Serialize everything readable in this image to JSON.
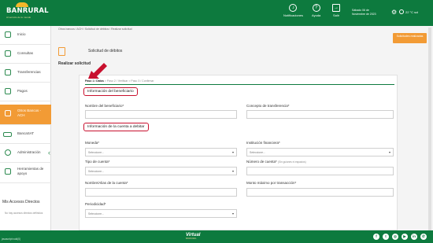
{
  "header": {
    "logo_name": "BANRURAL",
    "logo_tagline": "Al servicio de tu mundo",
    "notifications_label": "Notificaciones",
    "help_label": "Ayuda",
    "exit_label": "Salir",
    "date_line1": "Sábado 06 de",
    "date_line2": "Noviembre de 2023",
    "temperature": "22 °C sol"
  },
  "sidebar": {
    "items": [
      {
        "label": "Inicio"
      },
      {
        "label": "Consultas"
      },
      {
        "label": "Transferencias"
      },
      {
        "label": "Pagos"
      },
      {
        "label": "Gestiones"
      },
      {
        "label": "Otros Bancos - ACH"
      },
      {
        "label": "BancaSAT"
      },
      {
        "label": "Administración"
      },
      {
        "label": "Herramientas de apoyo"
      }
    ],
    "access_title": "Mis Accesos Directos",
    "access_note": "No hay accesos directos definidos"
  },
  "main": {
    "breadcrumb": "Otros bancos / ACH / Solicitud de débitos / Realizar solicitud",
    "top_button": "Solicitudes realizadas",
    "page_title": "Solicitud de débitos",
    "section_title": "Realizar solicitud",
    "steps": {
      "current": "Paso 1 / Datos",
      "rest": "  >  Paso 2 / Verificar  >  Paso 3 / Confirmar"
    },
    "beneficiary_heading": "Información del beneficiario",
    "account_heading": "Información de la cuenta a debitar",
    "fields": {
      "beneficiary_name": {
        "label": "Nombre del beneficiario*",
        "value": ""
      },
      "transfer_concept": {
        "label": "Concepto de transferencia*",
        "value": ""
      },
      "currency": {
        "label": "Moneda*",
        "value": "Seleccione..."
      },
      "institution": {
        "label": "Institución financiera*",
        "value": "Seleccione..."
      },
      "account_type": {
        "label": "Tipo de cuenta*",
        "value": "Seleccione..."
      },
      "account_number": {
        "label": "Número de cuenta*",
        "hint": "(Sin guiones ni espacios)",
        "value": ""
      },
      "account_name": {
        "label": "Nombre/Alias de la cuenta*",
        "value": ""
      },
      "max_amount": {
        "label": "Monto máximo por transacción*",
        "value": ""
      },
      "periodicity": {
        "label": "Periodicidad*",
        "value": "Seleccione..."
      }
    }
  },
  "footer": {
    "left": "javascript:void(0)",
    "center_brand": "Virtual",
    "center_tag": "BANRURAL",
    "social": [
      {
        "icon": "facebook-icon",
        "glyph": "f"
      },
      {
        "icon": "twitter-icon",
        "glyph": "t"
      },
      {
        "icon": "instagram-icon",
        "glyph": "◎"
      },
      {
        "icon": "youtube-icon",
        "glyph": "▶"
      },
      {
        "icon": "linkedin-icon",
        "glyph": "in"
      },
      {
        "icon": "whatsapp-icon",
        "glyph": "✆"
      }
    ]
  },
  "colors": {
    "brand_green": "#0d7a3e",
    "accent_orange": "#f29b35",
    "highlight_red": "#c8102e"
  }
}
